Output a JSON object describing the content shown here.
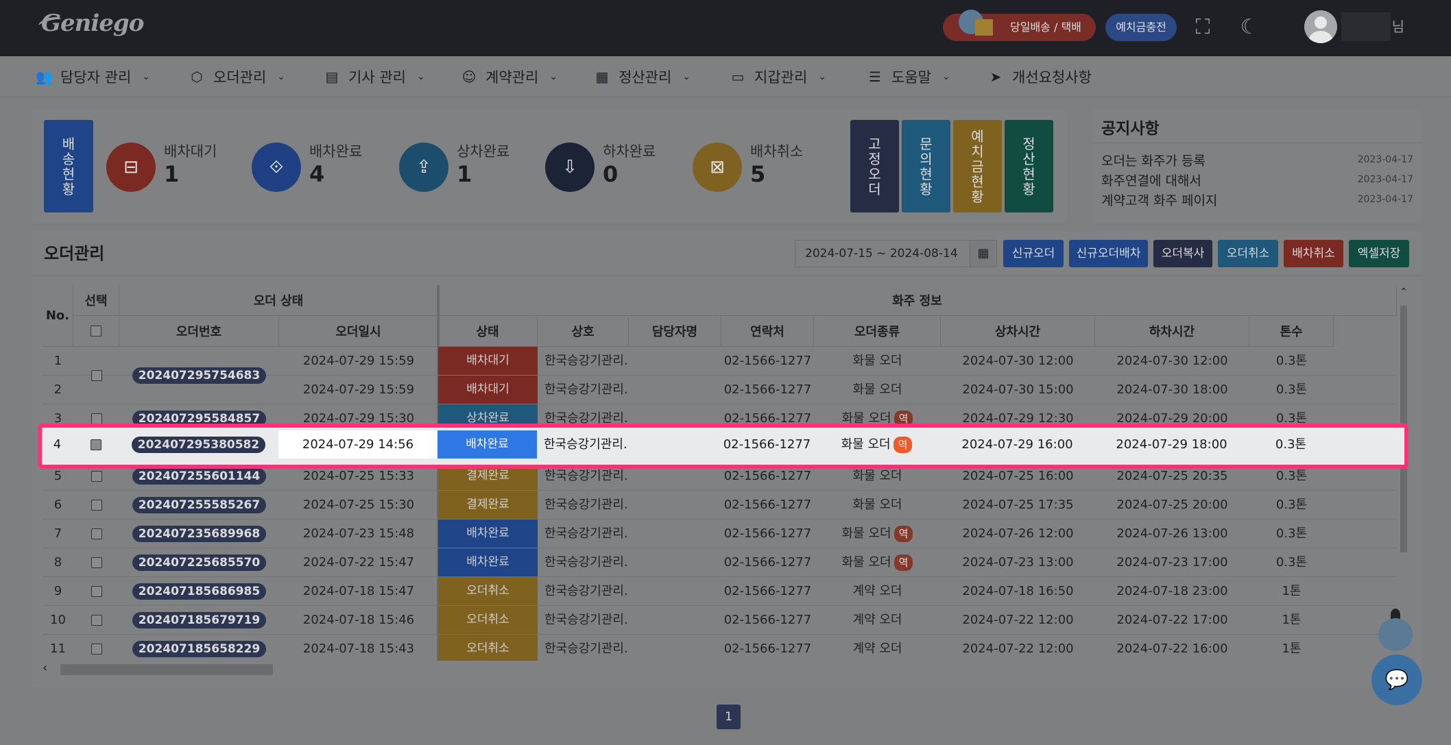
{
  "topbar": {
    "logo": "Geniego",
    "promo_label": "당일배송 / 택배",
    "charge_label": "예치금충전",
    "user_suffix": "님"
  },
  "nav": [
    {
      "label": "담당자 관리",
      "icon": "users-icon",
      "has_dropdown": true
    },
    {
      "label": "오더관리",
      "icon": "box-icon",
      "has_dropdown": true
    },
    {
      "label": "기사 관리",
      "icon": "id-card-icon",
      "has_dropdown": true
    },
    {
      "label": "계약관리",
      "icon": "handshake-icon",
      "has_dropdown": true
    },
    {
      "label": "정산관리",
      "icon": "calculator-icon",
      "has_dropdown": true
    },
    {
      "label": "지갑관리",
      "icon": "wallet-icon",
      "has_dropdown": true
    },
    {
      "label": "도움말",
      "icon": "list-icon",
      "has_dropdown": true
    },
    {
      "label": "개선요청사항",
      "icon": "send-icon",
      "has_dropdown": false
    }
  ],
  "delivery_status": {
    "label": "배송현황",
    "stats": [
      {
        "label": "배차대기",
        "value": "1",
        "icon": "truck-icon",
        "color": "#7a2a22"
      },
      {
        "label": "배차완료",
        "value": "4",
        "icon": "route-icon",
        "color": "#1f4184"
      },
      {
        "label": "상차완료",
        "value": "1",
        "icon": "upload-box-icon",
        "color": "#1d4d6d"
      },
      {
        "label": "하차완료",
        "value": "0",
        "icon": "download-box-icon",
        "color": "#1d2336"
      },
      {
        "label": "배차취소",
        "value": "5",
        "icon": "cancel-box-icon",
        "color": "#7f6121"
      }
    ],
    "side_buttons": [
      {
        "label": "고정오더",
        "color": "#252c43"
      },
      {
        "label": "문의현황",
        "color": "#1e587a"
      },
      {
        "label": "예치금현황",
        "color": "#7f6120"
      },
      {
        "label": "정산현황",
        "color": "#114c40"
      }
    ]
  },
  "notice": {
    "title": "공지사항",
    "items": [
      {
        "title": "오더는 화주가 등록",
        "date": "2023-04-17"
      },
      {
        "title": "화주연결에 대해서",
        "date": "2023-04-17"
      },
      {
        "title": "계약고객 화주 페이지",
        "date": "2023-04-17"
      }
    ]
  },
  "orders": {
    "title": "오더관리",
    "date_range": "2024-07-15 ~ 2024-08-14",
    "actions": [
      {
        "label": "신규오더",
        "color": "#1f4488"
      },
      {
        "label": "신규오더배차",
        "color": "#1f4488"
      },
      {
        "label": "오더복사",
        "color": "#252c43"
      },
      {
        "label": "오더취소",
        "color": "#1e587a"
      },
      {
        "label": "배차취소",
        "color": "#7a2a22"
      },
      {
        "label": "엑셀저장",
        "color": "#114c40"
      }
    ],
    "group_headers": {
      "no": "No.",
      "select": "선택",
      "order_status": "오더 상태",
      "shipper_info": "화주 정보"
    },
    "columns": [
      "오더번호",
      "오더일시",
      "상태",
      "상호",
      "담당자명",
      "연락처",
      "오더종류",
      "상차시간",
      "하차시간",
      "톤수"
    ],
    "status_colors": {
      "배차대기": "#7a2a22",
      "상차완료": "#1e587a",
      "배차완료": "#1f4488",
      "결제완료": "#7f6120",
      "오더취소": "#7f6120"
    },
    "reverse_label": "역",
    "rows": [
      {
        "no": "1",
        "order_no": "202407295754683",
        "order_time": "2024-07-29 15:59",
        "status": "배차대기",
        "company": "한국승강기관리…",
        "manager": "",
        "contact": "02-1566-1277",
        "type": "화물 오더",
        "rev": false,
        "load": "2024-07-30 12:00",
        "unload": "2024-07-30 12:00",
        "ton": "0.3톤"
      },
      {
        "no": "2",
        "order_no": "",
        "order_time": "2024-07-29 15:59",
        "status": "배차대기",
        "company": "한국승강기관리…",
        "manager": "",
        "contact": "02-1566-1277",
        "type": "화물 오더",
        "rev": false,
        "load": "2024-07-30 15:00",
        "unload": "2024-07-30 18:00",
        "ton": "0.3톤"
      },
      {
        "no": "3",
        "order_no": "202407295584857",
        "order_time": "2024-07-29 15:30",
        "status": "상차완료",
        "company": "한국승강기관리…",
        "manager": "",
        "contact": "02-1566-1277",
        "type": "화물 오더",
        "rev": true,
        "load": "2024-07-29 12:30",
        "unload": "2024-07-29 20:00",
        "ton": "0.3톤"
      },
      {
        "no": "4",
        "order_no": "202407295380582",
        "order_time": "2024-07-29 14:56",
        "status": "배차완료",
        "company": "한국승강기관리…",
        "manager": "",
        "contact": "02-1566-1277",
        "type": "화물 오더",
        "rev": true,
        "load": "2024-07-29 16:00",
        "unload": "2024-07-29 18:00",
        "ton": "0.3톤"
      },
      {
        "no": "5",
        "order_no": "202407255601144",
        "order_time": "2024-07-25 15:33",
        "status": "결제완료",
        "company": "한국승강기관리…",
        "manager": "",
        "contact": "02-1566-1277",
        "type": "화물 오더",
        "rev": false,
        "load": "2024-07-25 16:00",
        "unload": "2024-07-25 20:35",
        "ton": "0.3톤"
      },
      {
        "no": "6",
        "order_no": "202407255585267",
        "order_time": "2024-07-25 15:30",
        "status": "결제완료",
        "company": "한국승강기관리…",
        "manager": "",
        "contact": "02-1566-1277",
        "type": "화물 오더",
        "rev": false,
        "load": "2024-07-25 17:35",
        "unload": "2024-07-25 20:00",
        "ton": "0.3톤"
      },
      {
        "no": "7",
        "order_no": "202407235689968",
        "order_time": "2024-07-23 15:48",
        "status": "배차완료",
        "company": "한국승강기관리…",
        "manager": "",
        "contact": "02-1566-1277",
        "type": "화물 오더",
        "rev": true,
        "load": "2024-07-26 12:00",
        "unload": "2024-07-26 13:00",
        "ton": "0.3톤"
      },
      {
        "no": "8",
        "order_no": "202407225685570",
        "order_time": "2024-07-22 15:47",
        "status": "배차완료",
        "company": "한국승강기관리…",
        "manager": "",
        "contact": "02-1566-1277",
        "type": "화물 오더",
        "rev": true,
        "load": "2024-07-23 13:00",
        "unload": "2024-07-23 17:00",
        "ton": "0.3톤"
      },
      {
        "no": "9",
        "order_no": "202407185686985",
        "order_time": "2024-07-18 15:47",
        "status": "오더취소",
        "company": "한국승강기관리…",
        "manager": "",
        "contact": "02-1566-1277",
        "type": "계약 오더",
        "rev": false,
        "load": "2024-07-18 16:50",
        "unload": "2024-07-18 23:00",
        "ton": "1톤"
      },
      {
        "no": "10",
        "order_no": "202407185679719",
        "order_time": "2024-07-18 15:46",
        "status": "오더취소",
        "company": "한국승강기관리…",
        "manager": "",
        "contact": "02-1566-1277",
        "type": "계약 오더",
        "rev": false,
        "load": "2024-07-22 12:00",
        "unload": "2024-07-22 17:00",
        "ton": "1톤"
      },
      {
        "no": "11",
        "order_no": "202407185658229",
        "order_time": "2024-07-18 15:43",
        "status": "오더취소",
        "company": "한국승강기관리…",
        "manager": "",
        "contact": "02-1566-1277",
        "type": "계약 오더",
        "rev": false,
        "load": "2024-07-22 12:00",
        "unload": "2024-07-22 16:00",
        "ton": "1톤"
      }
    ],
    "highlight_row": 4
  },
  "pagination": {
    "current": "1"
  }
}
